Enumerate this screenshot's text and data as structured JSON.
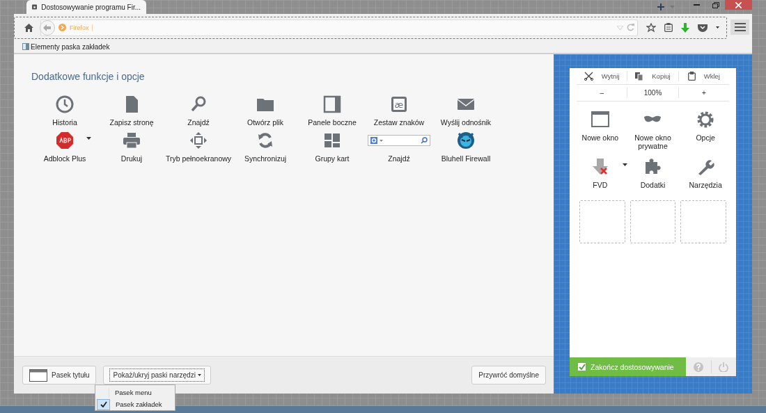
{
  "tab": {
    "title": "Dostosowywanie programu Fir..."
  },
  "navigation": {
    "identity_label": "Firefox"
  },
  "bookmarks_toolbar": {
    "label": "Elementy paska zakładek"
  },
  "palette": {
    "title": "Dodatkowe funkcje i opcje",
    "items": [
      {
        "label": "Historia",
        "kind": "button",
        "dropdown": false
      },
      {
        "label": "Zapisz stronę",
        "kind": "button",
        "dropdown": false
      },
      {
        "label": "Znajdź",
        "kind": "button",
        "dropdown": false
      },
      {
        "label": "Otwórz plik",
        "kind": "button",
        "dropdown": false
      },
      {
        "label": "Panele boczne",
        "kind": "button",
        "dropdown": false
      },
      {
        "label": "Zestaw znaków",
        "kind": "button",
        "dropdown": false,
        "icon_glyph": "æ"
      },
      {
        "label": "Wyślij odnośnik",
        "kind": "button",
        "dropdown": false
      },
      {
        "label": "Adblock Plus",
        "kind": "button",
        "dropdown": true
      },
      {
        "label": "Drukuj",
        "kind": "button",
        "dropdown": false
      },
      {
        "label": "Tryb pełnoekranowy",
        "kind": "button",
        "dropdown": false
      },
      {
        "label": "Synchronizuj",
        "kind": "button",
        "dropdown": false
      },
      {
        "label": "Grupy kart",
        "kind": "button",
        "dropdown": false
      },
      {
        "label": "Znajdź",
        "kind": "search",
        "dropdown": false
      },
      {
        "label": "Bluhell Firewall",
        "kind": "button",
        "dropdown": false
      }
    ]
  },
  "menu_panel": {
    "edit": [
      "Wytnij",
      "Kopiuj",
      "Wklej"
    ],
    "zoom": {
      "minus": "–",
      "level": "100%",
      "plus": "+"
    },
    "items": [
      {
        "label": "Nowe okno",
        "dropdown": false
      },
      {
        "label": "Nowe okno prywatne",
        "dropdown": false
      },
      {
        "label": "Opcje",
        "dropdown": false
      },
      {
        "label": "FVD",
        "dropdown": true
      },
      {
        "label": "Dodatki",
        "dropdown": false
      },
      {
        "label": "Narzędzia",
        "dropdown": false
      }
    ],
    "done_button": {
      "label": "Zakończ dostosowywanie",
      "checked": true
    }
  },
  "bottom_bar": {
    "title_bar_button": "Pasek tytułu",
    "toolbars_button": "Pokaż/ukryj paski narzędzi",
    "restore_button": "Przywróć domyślne"
  },
  "toolbars_menu": [
    {
      "label": "Pasek menu",
      "checked": false
    },
    {
      "label": "Pasek zakładek",
      "checked": true
    }
  ]
}
